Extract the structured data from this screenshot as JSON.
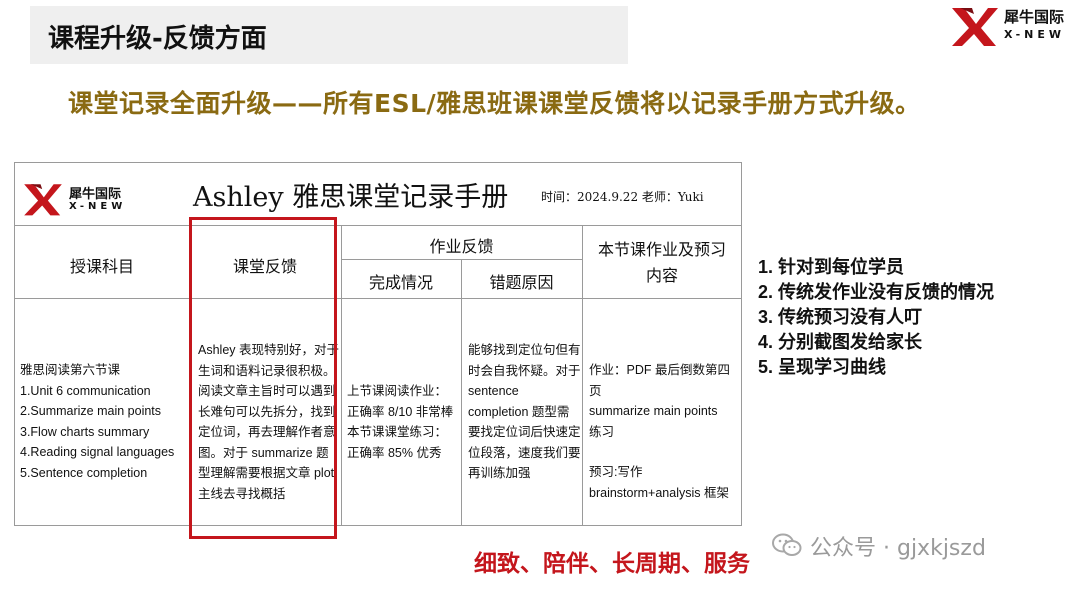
{
  "slide": {
    "title": "课程升级-反馈方面",
    "brand_cn": "犀牛国际",
    "brand_en": "X-NEW",
    "headline": "课堂记录全面升级——所有ESL/雅思班课课堂反馈将以记录手册方式升级。",
    "slogan": "细致、陪伴、长周期、服务",
    "watermark": "公众号 · gjxkjszd",
    "points": [
      "1.  针对到每位学员",
      "2.  传统发作业没有反馈的情况",
      "3.  传统预习没有人叮",
      "4.  分别截图发给家长",
      "5.  呈现学习曲线"
    ]
  },
  "doc": {
    "logo_cn": "犀牛国际",
    "logo_en": "X-NEW",
    "title": "Ashley 雅思课堂记录手册",
    "meta": "时间：2024.9.22  老师：Yuki",
    "headers": {
      "subject": "授课科目",
      "feedback": "课堂反馈",
      "homework_feedback": "作业反馈",
      "completion": "完成情况",
      "error_reason": "错题原因",
      "next": "本节课作业及预习内容"
    },
    "subject_lines": [
      "雅思阅读第六节课",
      "1.Unit 6 communication",
      "2.Summarize main points",
      "3.Flow charts summary",
      "4.Reading signal languages",
      "5.Sentence completion"
    ],
    "feedback_lines": [
      "Ashley 表现特别好，对于",
      "生词和语料记录很积极。",
      "阅读文章主旨时可以遇到",
      "长难句可以先拆分，找到",
      "定位词，再去理解作者意",
      "图。对于 summarize 题",
      "型理解需要根据文章 plot",
      "主线去寻找概括"
    ],
    "completion_lines": [
      "上节课阅读作业：",
      "正确率 8/10 非常棒",
      "本节课课堂练习：",
      "正确率 85% 优秀"
    ],
    "error_lines": [
      "能够找到定位句但有",
      "时会自我怀疑。对于",
      "sentence",
      "completion 题型需",
      "要找定位词后快速定",
      "位段落，速度我们要",
      "再训练加强"
    ],
    "next_lines": [
      "作业：PDF 最后倒数第四页",
      "summarize main points",
      "练习",
      "",
      "预习:写作",
      "brainstorm+analysis 框架"
    ]
  },
  "colors": {
    "accent_red": "#c4161c",
    "headline_gold": "#8a6a12",
    "grey_bar": "#efefef"
  },
  "icons": [
    "xnew-logo-icon",
    "wechat-icon"
  ]
}
